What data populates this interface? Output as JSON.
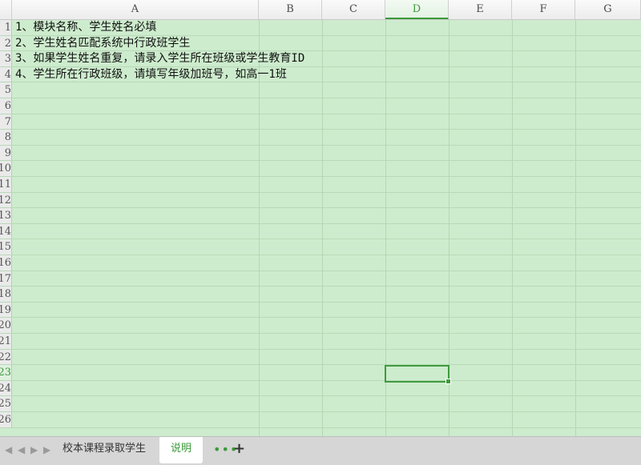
{
  "columns": [
    "A",
    "B",
    "C",
    "D",
    "E",
    "F",
    "G"
  ],
  "active_column": "D",
  "row_numbers": [
    "1",
    "2",
    "3",
    "4",
    "5",
    "6",
    "7",
    "8",
    "9",
    "10",
    "11",
    "12",
    "13",
    "14",
    "15",
    "16",
    "17",
    "18",
    "19",
    "20",
    "21",
    "22",
    "23",
    "24",
    "25",
    "26"
  ],
  "active_row": "23",
  "cells": {
    "A1": "1、模块名称、学生姓名必填",
    "A2": "2、学生姓名匹配系统中行政班学生",
    "A3": "3、如果学生姓名重复，请录入学生所在班级或学生教育ID",
    "A4": "4、学生所在行政班级，请填写年级加班号，如高一1班"
  },
  "selected_cell": "D23",
  "sheet_tabs": [
    {
      "label": "校本课程录取学生",
      "active": false
    },
    {
      "label": "说明",
      "active": true
    }
  ],
  "tab_controls": {
    "first_icon": "first-sheet-icon",
    "prev_icon": "prev-sheet-icon",
    "next_icon": "next-sheet-icon",
    "last_icon": "last-sheet-icon",
    "more_icon": "more-sheets-icon",
    "more_glyph": "•••",
    "add_icon": "add-sheet-icon",
    "add_glyph": "+"
  },
  "colors": {
    "cell_background": "#cdeccd",
    "accent": "#3a9a3a"
  }
}
